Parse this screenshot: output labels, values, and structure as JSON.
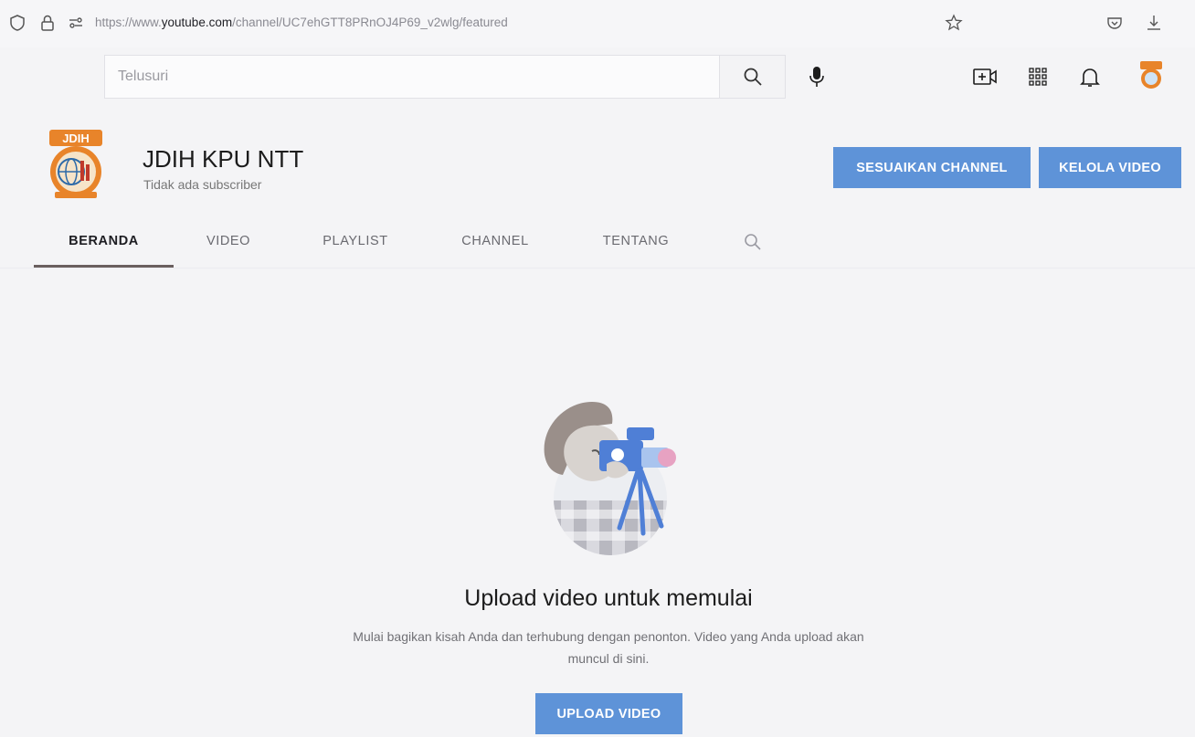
{
  "browser": {
    "url_prefix": "https://www.",
    "url_domain": "youtube.com",
    "url_path": "/channel/UC7ehGTT8PRnOJ4P69_v2wlg/featured"
  },
  "header": {
    "search_placeholder": "Telusuri"
  },
  "channel": {
    "avatar_text": "JDIH",
    "name": "JDIH KPU NTT",
    "subscribers": "Tidak ada subscriber",
    "customize_label": "SESUAIKAN CHANNEL",
    "manage_label": "KELOLA VIDEO"
  },
  "tabs": [
    {
      "label": "BERANDA",
      "active": true
    },
    {
      "label": "VIDEO"
    },
    {
      "label": "PLAYLIST"
    },
    {
      "label": "CHANNEL"
    },
    {
      "label": "TENTANG"
    }
  ],
  "empty_state": {
    "title": "Upload video untuk memulai",
    "description": "Mulai bagikan kisah Anda dan terhubung dengan penonton. Video yang Anda upload akan muncul di sini.",
    "button_label": "UPLOAD VIDEO"
  },
  "colors": {
    "accent_blue": "#5e93d8",
    "avatar_orange": "#e8842a"
  }
}
